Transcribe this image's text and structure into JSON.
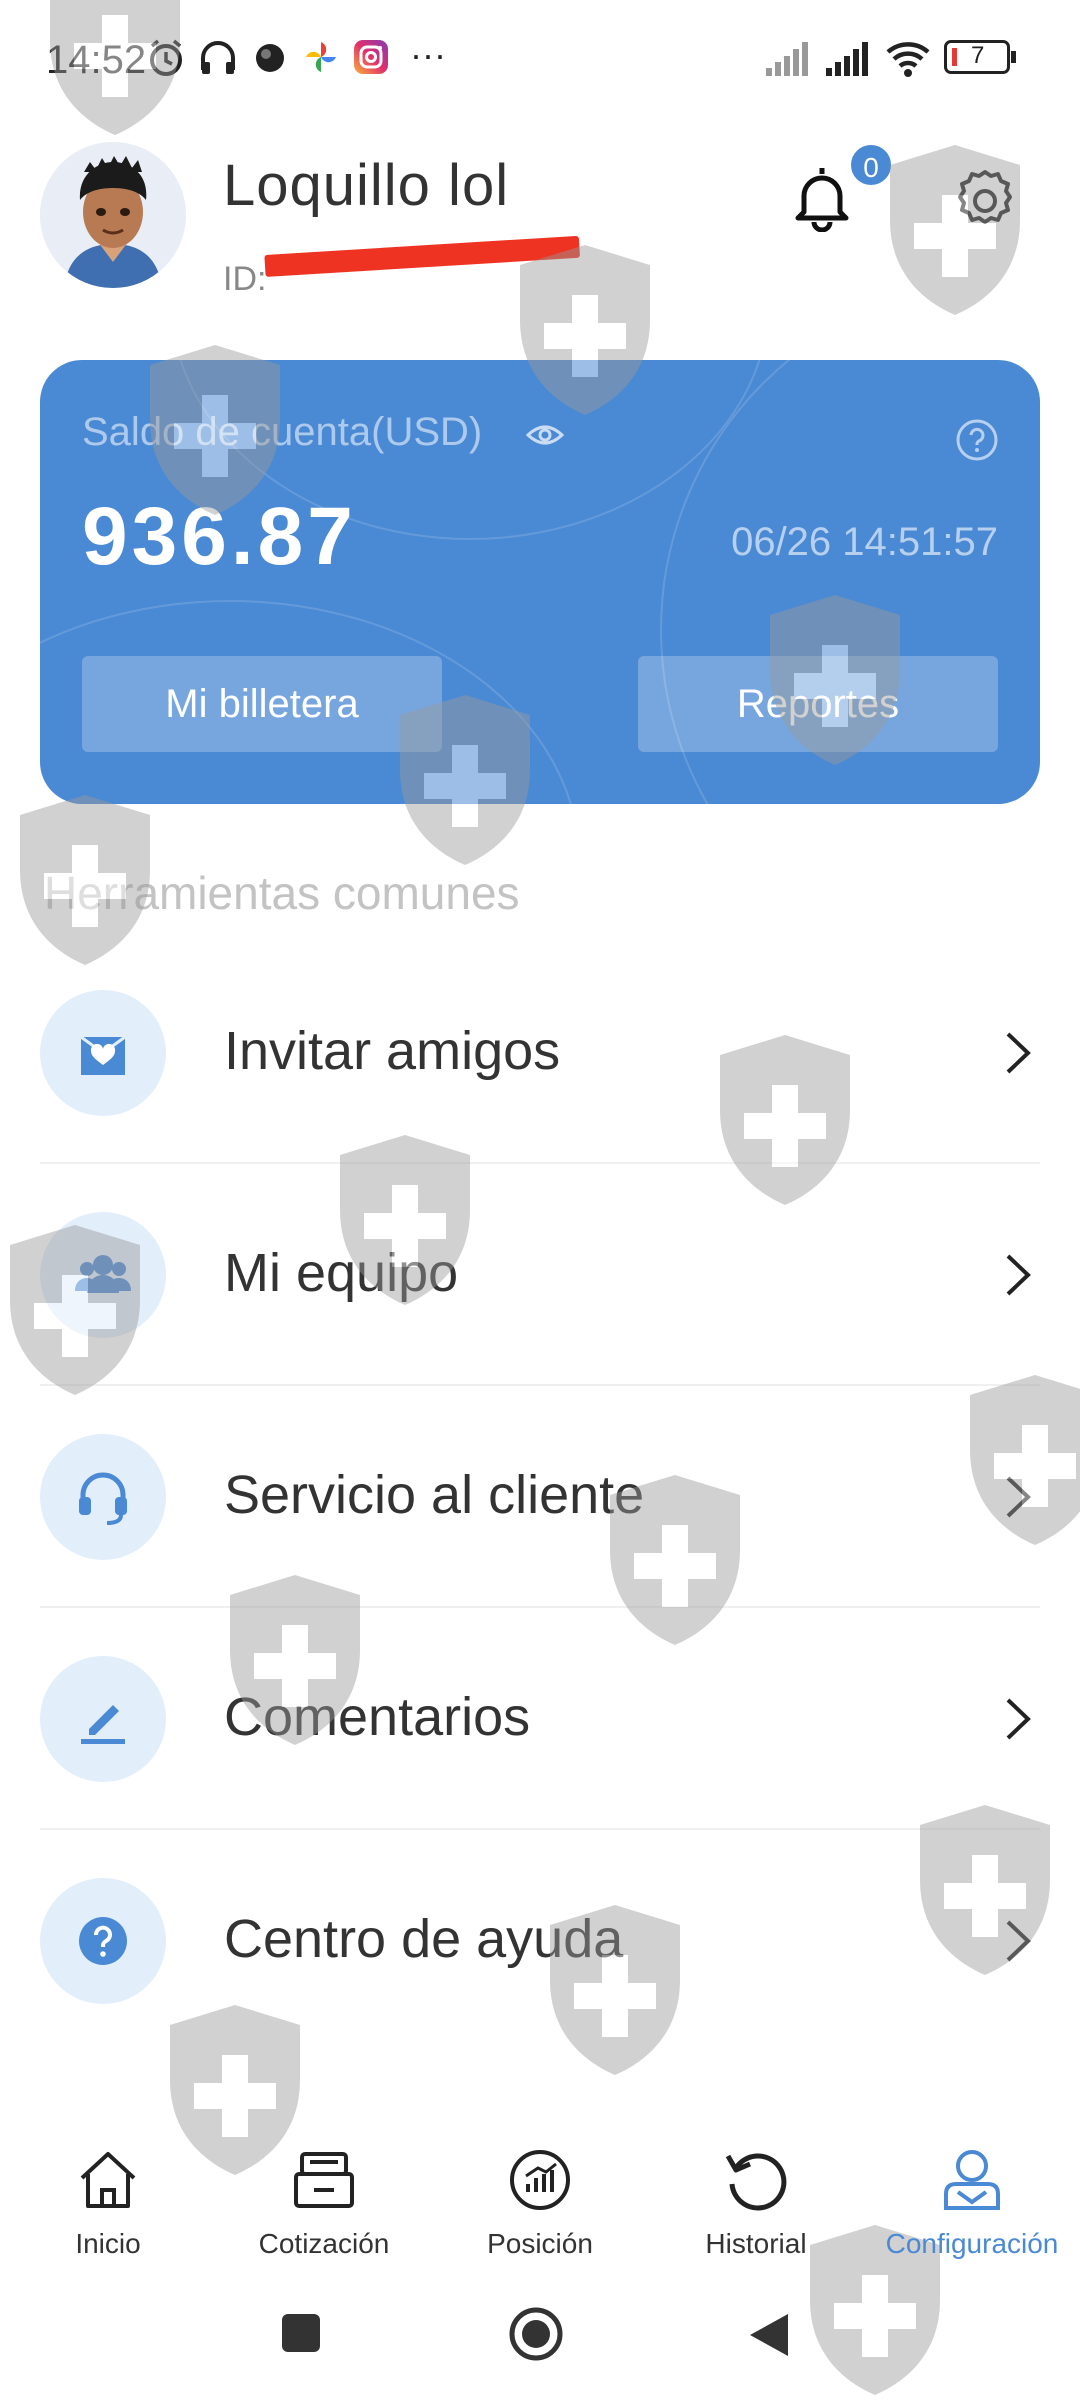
{
  "status_bar": {
    "time": "14:52",
    "more": "···",
    "battery": "7",
    "icons": [
      "alarm-icon",
      "headphones-icon",
      "app-dot-icon",
      "photos-icon",
      "instagram-icon",
      "signal-icon",
      "signal-icon",
      "wifi-icon",
      "battery-icon"
    ]
  },
  "profile": {
    "name": "Loquillo lol",
    "id_label": "ID:",
    "notifications_count": "0"
  },
  "balance_card": {
    "label": "Saldo de cuenta(USD)",
    "amount": "936.87",
    "timestamp": "06/26 14:51:57",
    "wallet_button": "Mi billetera",
    "reports_button": "Reportes",
    "color": "#4a89d4"
  },
  "tools": {
    "title": "Herramientas comunes",
    "items": [
      {
        "label": "Invitar amigos",
        "icon": "invite-icon"
      },
      {
        "label": "Mi equipo",
        "icon": "team-icon"
      },
      {
        "label": "Servicio al cliente",
        "icon": "headset-icon"
      },
      {
        "label": "Comentarios",
        "icon": "edit-icon"
      },
      {
        "label": "Centro de ayuda",
        "icon": "help-icon"
      }
    ]
  },
  "bottom_nav": {
    "items": [
      {
        "label": "Inicio",
        "icon": "home-icon"
      },
      {
        "label": "Cotización",
        "icon": "quote-icon"
      },
      {
        "label": "Posición",
        "icon": "position-icon"
      },
      {
        "label": "Historial",
        "icon": "history-icon"
      },
      {
        "label": "Configuración",
        "icon": "profile-icon",
        "active": true
      }
    ],
    "active_color": "#4a89d4"
  }
}
